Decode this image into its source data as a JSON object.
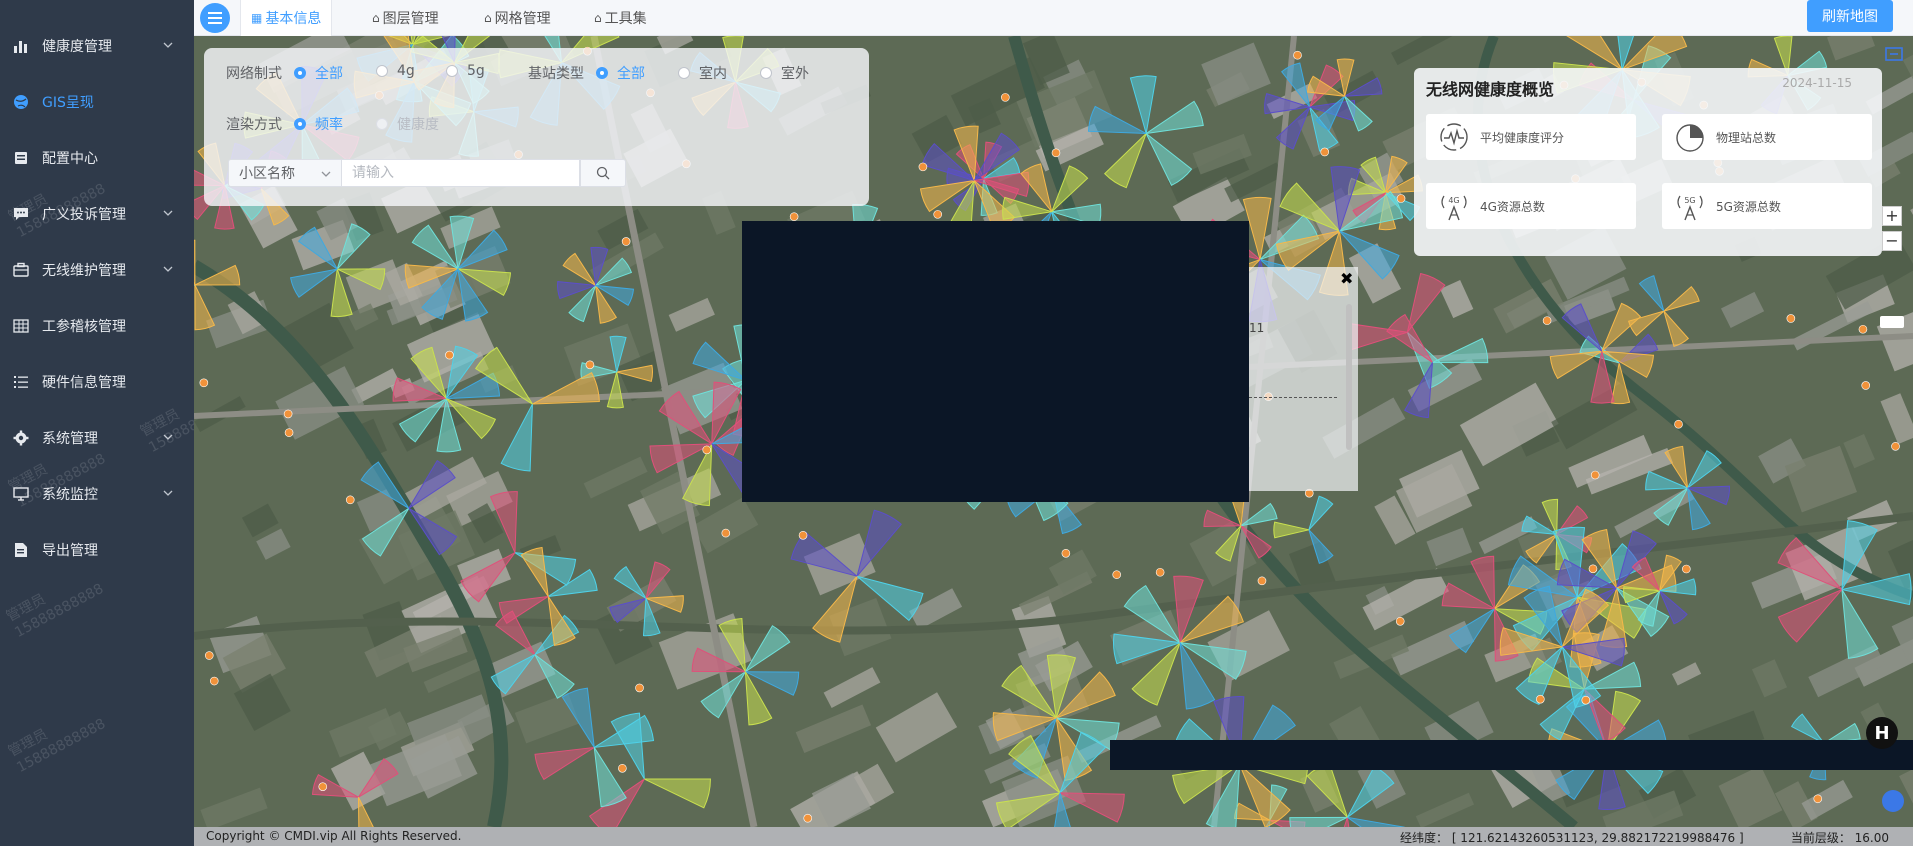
{
  "sidebar": {
    "items": [
      {
        "label": "健康度管理",
        "icon": "bar-chart-icon",
        "expandable": true,
        "active": false
      },
      {
        "label": "GIS呈现",
        "icon": "globe-icon",
        "expandable": false,
        "active": true
      },
      {
        "label": "配置中心",
        "icon": "document-icon",
        "expandable": false,
        "active": false
      },
      {
        "label": "广义投诉管理",
        "icon": "chat-icon",
        "expandable": true,
        "active": false
      },
      {
        "label": "无线维护管理",
        "icon": "briefcase-icon",
        "expandable": true,
        "active": false
      },
      {
        "label": "工参稽核管理",
        "icon": "grid-icon",
        "expandable": false,
        "active": false
      },
      {
        "label": "硬件信息管理",
        "icon": "list-icon",
        "expandable": false,
        "active": false
      },
      {
        "label": "系统管理",
        "icon": "gear-icon",
        "expandable": true,
        "active": false
      },
      {
        "label": "系统监控",
        "icon": "monitor-icon",
        "expandable": true,
        "active": false
      },
      {
        "label": "导出管理",
        "icon": "export-icon",
        "expandable": false,
        "active": false
      }
    ],
    "watermark": "管理员\n15888888888"
  },
  "topbar": {
    "tabs": [
      {
        "label": "基本信息",
        "icon": "grid-icon",
        "active": true
      },
      {
        "label": "图层管理",
        "icon": "folder-icon",
        "active": false
      },
      {
        "label": "网格管理",
        "icon": "folder-icon",
        "active": false
      },
      {
        "label": "工具集",
        "icon": "folder-icon",
        "active": false
      }
    ],
    "refresh_label": "刷新地图"
  },
  "filter": {
    "network_label": "网络制式",
    "network_options": [
      {
        "label": "全部",
        "state": "checked"
      },
      {
        "label": "4g",
        "state": "normal"
      },
      {
        "label": "5g",
        "state": "normal"
      }
    ],
    "station_label": "基站类型",
    "station_options": [
      {
        "label": "全部",
        "state": "checked"
      },
      {
        "label": "室内",
        "state": "normal"
      },
      {
        "label": "室外",
        "state": "normal"
      }
    ],
    "render_label": "渲染方式",
    "render_options": [
      {
        "label": "频率",
        "state": "checked"
      },
      {
        "label": "健康度",
        "state": "disabled"
      }
    ],
    "select_value": "小区名称",
    "search_placeholder": "请输入"
  },
  "health": {
    "title": "无线网健康度概览",
    "date": "2024-11-15",
    "cards": [
      {
        "label": "平均健康度评分",
        "icon": "heartbeat-icon"
      },
      {
        "label": "物理站总数",
        "icon": "pie-icon"
      },
      {
        "label": "4G资源总数",
        "icon": "antenna-4g-icon"
      },
      {
        "label": "5G资源总数",
        "icon": "antenna-5g-icon"
      }
    ]
  },
  "popup": {
    "partial_text": "11",
    "close_symbol": "✖"
  },
  "map_controls": {
    "zoom_in": "+",
    "zoom_out": "−",
    "badge": "H"
  },
  "footer": {
    "copyright": "Copyright © CMDI.vip All Rights Reserved.",
    "coords": "经纬度： [ 121.62143260531123, 29.882172219988476 ]",
    "zoom_level": "当前层级：  16.00"
  },
  "colors": {
    "sidebar_bg": "#2f3a4a",
    "accent": "#409eff",
    "popup_dark": "#0b1626"
  }
}
